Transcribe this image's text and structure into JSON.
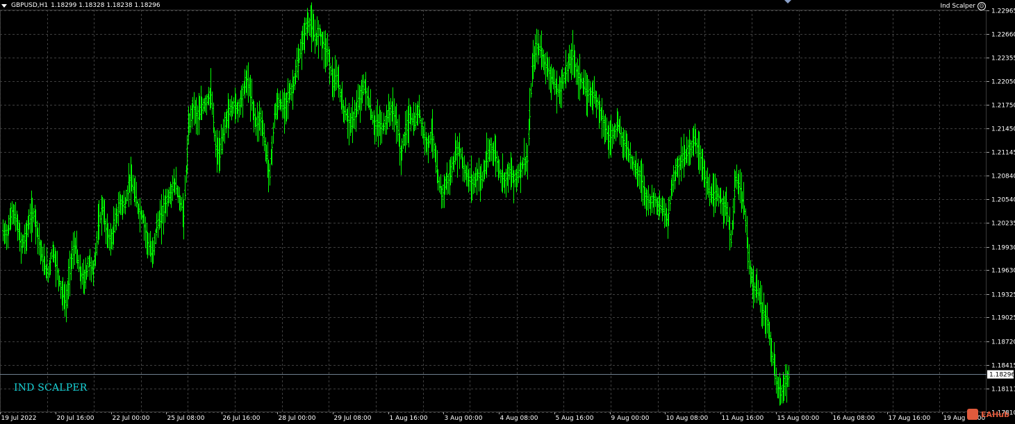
{
  "header": {
    "symbol": "GBPUSD,H1",
    "ohlc": "1.18299 1.18328 1.18238 1.18296"
  },
  "indicator": {
    "name": "Ind Scalper"
  },
  "overlay_label": "IND SCALPER",
  "watermark": "EAHub",
  "colors": {
    "background": "#000000",
    "bars": "#00ff00",
    "grid": "#404040",
    "price_line": "#708090",
    "label": "#19d3d8"
  },
  "chart_data": {
    "type": "line",
    "title": "",
    "price_axis_ticks": [
      "1.22965",
      "1.22660",
      "1.22355",
      "1.22050",
      "1.21750",
      "1.21450",
      "1.21145",
      "1.20840",
      "1.20540",
      "1.20235",
      "1.19930",
      "1.19630",
      "1.19325",
      "1.19025",
      "1.18720",
      "1.18415",
      "1.18111",
      "1.17810"
    ],
    "current_price": "1.18296",
    "time_axis_ticks": [
      "19 Jul 2022",
      "20 Jul 16:00",
      "22 Jul 00:00",
      "25 Jul 08:00",
      "26 Jul 16:00",
      "28 Jul 00:00",
      "29 Jul 08:00",
      "1 Aug 16:00",
      "3 Aug 00:00",
      "4 Aug 08:00",
      "5 Aug 16:00",
      "9 Aug 00:00",
      "10 Aug 08:00",
      "11 Aug 16:00",
      "15 Aug 00:00",
      "16 Aug 08:00",
      "17 Aug 16:00",
      "19 Aug 00:00"
    ],
    "ylim": [
      1.1781,
      1.2297
    ],
    "series": [
      {
        "close": [
          1.201,
          1.204,
          1.2025,
          1.1995,
          1.2005,
          1.203,
          1.2035,
          1.2,
          1.197,
          1.196,
          1.199,
          1.1965,
          1.1935,
          1.192,
          1.1975,
          1.1995,
          1.196,
          1.195,
          1.1975,
          1.196,
          1.2015,
          1.2045,
          1.201,
          1.2,
          1.203,
          1.205,
          1.2045,
          1.208,
          1.2065,
          1.204,
          1.203,
          1.2,
          1.198,
          1.202,
          1.203,
          1.205,
          1.206,
          1.2075,
          1.2055,
          1.2035,
          1.214,
          1.2175,
          1.216,
          1.217,
          1.218,
          1.219,
          1.212,
          1.211,
          1.215,
          1.2165,
          1.2175,
          1.217,
          1.219,
          1.221,
          1.218,
          1.215,
          1.216,
          1.212,
          1.2085,
          1.216,
          1.218,
          1.217,
          1.2185,
          1.2195,
          1.222,
          1.225,
          1.2275,
          1.228,
          1.226,
          1.227,
          1.225,
          1.224,
          1.22,
          1.221,
          1.2175,
          1.216,
          1.215,
          1.2165,
          1.2185,
          1.22,
          1.2175,
          1.215,
          1.215,
          1.2145,
          1.216,
          1.217,
          1.2155,
          1.211,
          1.214,
          1.216,
          1.215,
          1.217,
          1.2135,
          1.2125,
          1.214,
          1.2085,
          1.206,
          1.2075,
          1.2085,
          1.211,
          1.212,
          1.209,
          1.208,
          1.2075,
          1.2085,
          1.208,
          1.2105,
          1.212,
          1.211,
          1.2085,
          1.208,
          1.209,
          1.208,
          1.2085,
          1.21,
          1.2105,
          1.222,
          1.225,
          1.2245,
          1.2225,
          1.2215,
          1.22,
          1.219,
          1.221,
          1.2225,
          1.224,
          1.2215,
          1.2205,
          1.219,
          1.219,
          1.2185,
          1.217,
          1.215,
          1.213,
          1.214,
          1.215,
          1.213,
          1.212,
          1.2105,
          1.209,
          1.2085,
          1.206,
          1.205,
          1.2055,
          1.2045,
          1.204,
          1.2025,
          1.2075,
          1.2095,
          1.2105,
          1.211,
          1.212,
          1.213,
          1.2115,
          1.209,
          1.2065,
          1.2055,
          1.206,
          1.205,
          1.2045,
          1.2,
          1.208,
          1.207,
          1.204,
          1.197,
          1.194,
          1.1935,
          1.191,
          1.19,
          1.186,
          1.182,
          1.1805,
          1.182,
          1.183
        ]
      }
    ]
  }
}
